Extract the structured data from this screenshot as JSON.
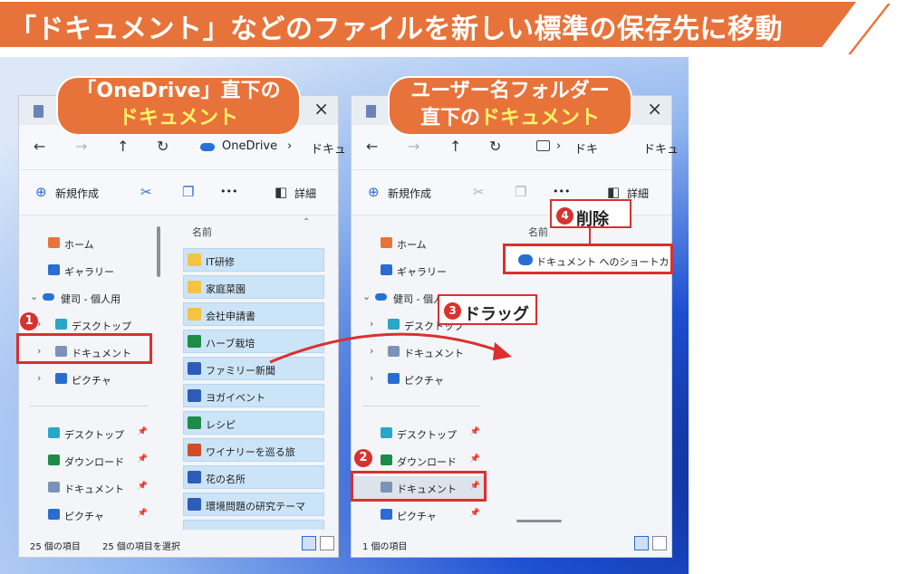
{
  "banner": {
    "title": "「ドキュメント」などのファイルを新しい標準の保存先に移動"
  },
  "callouts": {
    "left": {
      "line1": "「OneDrive」直下の",
      "line2": "ドキュメント"
    },
    "right": {
      "line1": "ユーザー名フォルダー",
      "line2_prefix": "直下の",
      "line2": "ドキュメント"
    }
  },
  "left_window": {
    "address": {
      "crumb1": "OneDrive",
      "sep": "›",
      "crumb2": "ドキュ"
    },
    "toolbar": {
      "new_label": "新規作成",
      "details_label": "詳細",
      "more": "•••"
    },
    "sidebar": [
      {
        "label": "ホーム",
        "icon": "home-icon"
      },
      {
        "label": "ギャラリー",
        "icon": "gallery-icon"
      },
      {
        "label": "健司 - 個人用",
        "icon": "cloud-icon"
      },
      {
        "label": "デスクトップ",
        "icon": "desktop-icon"
      },
      {
        "label": "ドキュメント",
        "icon": "documents-icon"
      },
      {
        "label": "ピクチャ",
        "icon": "pictures-icon"
      },
      {
        "label": "デスクトップ",
        "icon": "desktop-icon"
      },
      {
        "label": "ダウンロード",
        "icon": "download-icon"
      },
      {
        "label": "ドキュメント",
        "icon": "documents-icon"
      },
      {
        "label": "ピクチャ",
        "icon": "pictures-icon"
      }
    ],
    "column_header": "名前",
    "files": [
      {
        "name": "IT研修",
        "type": "folder"
      },
      {
        "name": "家庭菜園",
        "type": "folder"
      },
      {
        "name": "会社申請書",
        "type": "folder"
      },
      {
        "name": "ハーブ栽培",
        "type": "excel"
      },
      {
        "name": "ファミリー新聞",
        "type": "word"
      },
      {
        "name": "ヨガイベント",
        "type": "word"
      },
      {
        "name": "レシピ",
        "type": "excel"
      },
      {
        "name": "ワイナリーを巡る旅",
        "type": "ppt"
      },
      {
        "name": "花の名所",
        "type": "word"
      },
      {
        "name": "環境問題の研究テーマ",
        "type": "word"
      }
    ],
    "status": {
      "count": "25 個の項目",
      "selected": "25 個の項目を選択"
    }
  },
  "right_window": {
    "address": {
      "crumb1": "ドキ",
      "sep": "›",
      "crumb2": "ドキュ"
    },
    "toolbar": {
      "new_label": "新規作成",
      "details_label": "詳細",
      "more": "•••"
    },
    "sidebar": [
      {
        "label": "ホーム",
        "icon": "home-icon"
      },
      {
        "label": "ギャラリー",
        "icon": "gallery-icon"
      },
      {
        "label": "健司 - 個人用",
        "icon": "cloud-icon"
      },
      {
        "label": "デスクトップ",
        "icon": "desktop-icon"
      },
      {
        "label": "ドキュメント",
        "icon": "documents-icon"
      },
      {
        "label": "ピクチャ",
        "icon": "pictures-icon"
      },
      {
        "label": "デスクトップ",
        "icon": "desktop-icon"
      },
      {
        "label": "ダウンロード",
        "icon": "download-icon"
      },
      {
        "label": "ドキュメント",
        "icon": "documents-icon"
      },
      {
        "label": "ピクチャ",
        "icon": "pictures-icon"
      }
    ],
    "column_header": "名前",
    "shortcut": "ドキュメント へのショートカット (One",
    "status": {
      "count": "1 個の項目"
    }
  },
  "steps": {
    "s1": "1",
    "s2": "2",
    "s3": "3",
    "s4": "4",
    "drag_label": "ドラッグ",
    "delete_label": "削除"
  },
  "colors": {
    "accent": "#e8733a",
    "highlight": "#d9312e",
    "selection": "#cce4f7"
  }
}
